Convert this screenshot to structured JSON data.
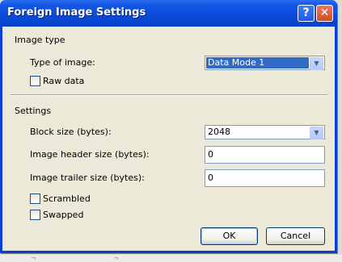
{
  "window": {
    "title": "Foreign Image Settings"
  },
  "title_buttons": {
    "help": "?",
    "close": "✕"
  },
  "image_type_group": {
    "heading": "Image type",
    "type_label": "Type of image:",
    "type_value": "Data Mode 1",
    "raw_data_label": "Raw data",
    "raw_data_checked": false
  },
  "settings_group": {
    "heading": "Settings",
    "block_size_label": "Block size (bytes):",
    "block_size_value": "2048",
    "header_size_label": "Image header size (bytes):",
    "header_size_value": "0",
    "trailer_size_label": "Image trailer size (bytes):",
    "trailer_size_value": "0",
    "scrambled_label": "Scrambled",
    "scrambled_checked": false,
    "swapped_label": "Swapped",
    "swapped_checked": false
  },
  "buttons": {
    "ok": "OK",
    "cancel": "Cancel"
  },
  "icons": {
    "dropdown": "chevron-down-icon"
  },
  "colors": {
    "titlebar": "#0a4ad8",
    "selection": "#316ac5",
    "client_bg": "#ece9d8"
  }
}
